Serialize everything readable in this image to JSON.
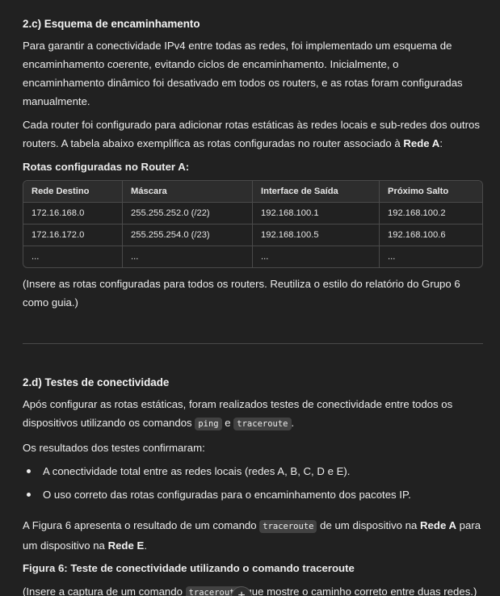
{
  "section_c": {
    "title": "2.c) Esquema de encaminhamento",
    "para1": "Para garantir a conectividade IPv4 entre todas as redes, foi implementado um esquema de encaminhamento coerente, evitando ciclos de encaminhamento. Inicialmente, o encaminhamento dinâmico foi desativado em todos os routers, e as rotas foram configuradas manualmente.",
    "para2_pre": "Cada router foi configurado para adicionar rotas estáticas às redes locais e sub-redes dos outros routers. A tabela abaixo exemplifica as rotas configuradas no router associado à ",
    "para2_bold": "Rede A",
    "para2_post": ":",
    "table_caption": "Rotas configuradas no Router A:",
    "table": {
      "headers": [
        "Rede Destino",
        "Máscara",
        "Interface de Saída",
        "Próximo Salto"
      ],
      "rows": [
        [
          "172.16.168.0",
          "255.255.252.0 (/22)",
          "192.168.100.1",
          "192.168.100.2"
        ],
        [
          "172.16.172.0",
          "255.255.254.0 (/23)",
          "192.168.100.5",
          "192.168.100.6"
        ],
        [
          "...",
          "...",
          "...",
          "..."
        ]
      ]
    },
    "note": "(Insere as rotas configuradas para todos os routers. Reutiliza o estilo do relatório do Grupo 6 como guia.)"
  },
  "section_d": {
    "title": "2.d) Testes de conectividade",
    "para1_pre": "Após configurar as rotas estáticas, foram realizados testes de conectividade entre todos os dispositivos utilizando os comandos ",
    "code_ping": "ping",
    "para1_mid": " e ",
    "code_traceroute": "traceroute",
    "para1_post": ".",
    "results_intro": "Os resultados dos testes confirmaram:",
    "bullets": [
      "A conectividade total entre as redes locais (redes A, B, C, D e E).",
      "O uso correto das rotas configuradas para o encaminhamento dos pacotes IP."
    ],
    "fig_pre": "A Figura 6 apresenta o resultado de um comando ",
    "fig_code": "traceroute",
    "fig_mid1": " de um dispositivo na ",
    "fig_bold1": "Rede A",
    "fig_mid2": " para um dispositivo na ",
    "fig_bold2": "Rede E",
    "fig_post": ".",
    "figure_caption": "Figura 6: Teste de conectividade utilizando o comando traceroute",
    "note_pre": "(Insere a captura de um comando ",
    "note_code": "traceroute",
    "note_post": " que mostre o caminho correto entre duas redes.)"
  },
  "ui": {
    "plus_symbol": "+",
    "plus_icon": "plus-icon"
  }
}
